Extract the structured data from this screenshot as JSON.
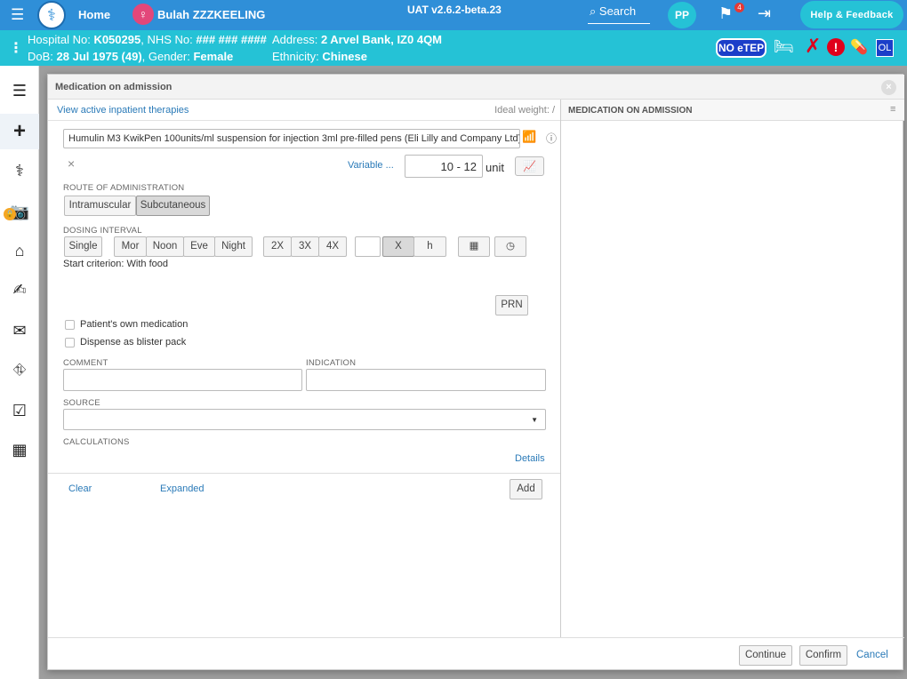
{
  "topbar": {
    "home_label": "Home",
    "patient_name": "Bulah ZZZKEELING",
    "version": "UAT v2.6.2-beta.23",
    "search_label": "Search",
    "user_initials": "PP",
    "flag_count": "4",
    "help_label": "Help & Feedback"
  },
  "patient": {
    "hospital_no_label": "Hospital No:",
    "hospital_no": "K050295",
    "nhs_no_label": ", NHS No:",
    "nhs_no": "### ### ####",
    "dob_label": "DoB:",
    "dob": "28 Jul 1975 (49)",
    "gender_label": ", Gender:",
    "gender": "Female",
    "address_label": "Address:",
    "address": "2 Arvel Bank, IZ0 4QM",
    "ethnicity_label": "Ethnicity:",
    "ethnicity": "Chinese",
    "badge_noetep": "NO eTEP",
    "badge_ol": "OL"
  },
  "modal": {
    "title": "Medication on admission",
    "view_link": "View active inpatient therapies",
    "ideal_weight": "Ideal weight: /",
    "right_title": "MEDICATION ON ADMISSION",
    "drug": "Humulin M3 KwikPen 100units/ml suspension for injection 3ml pre-filled pens (Eli Lilly and Company Ltd)",
    "variable_link": "Variable ...",
    "dose_value": "10 - 12",
    "dose_unit": "unit",
    "route_label": "ROUTE OF ADMINISTRATION",
    "routes": [
      "Intramuscular",
      "Subcutaneous"
    ],
    "dosing_label": "DOSING INTERVAL",
    "dosing_single": "Single",
    "dosing_times": [
      "Mor",
      "Noon",
      "Eve",
      "Night"
    ],
    "dosing_freq": [
      "2X",
      "3X",
      "4X"
    ],
    "dosing_x": "X",
    "dosing_h": "h",
    "start_criterion": "Start criterion: With food",
    "prn_label": "PRN",
    "own_med_label": "Patient's own medication",
    "blister_label": "Dispense as blister pack",
    "comment_label": "COMMENT",
    "indication_label": "INDICATION",
    "source_label": "SOURCE",
    "calculations_label": "CALCULATIONS",
    "details_link": "Details",
    "clear_link": "Clear",
    "expanded_link": "Expanded",
    "add_label": "Add",
    "continue_label": "Continue",
    "confirm_label": "Confirm",
    "cancel_label": "Cancel"
  },
  "colors": {
    "topbar": "#2f8fd8",
    "banner": "#25c2d6",
    "link": "#2a7ab8",
    "alert_red": "#e0001b",
    "badge_blue": "#1a3ec9"
  },
  "icons": [
    "menu-icon",
    "logo-icon",
    "patient-icon",
    "search-icon",
    "flag-icon",
    "logout-icon",
    "bed-icon",
    "x-icon",
    "alert-icon",
    "pill-icon",
    "list-icon",
    "plus-icon",
    "stethoscope-icon",
    "camera-icon",
    "lock-icon",
    "house-icon",
    "signature-icon",
    "inbox-icon",
    "running-icon",
    "checklist-icon",
    "building-icon",
    "wifi-icon",
    "info-icon",
    "chart-icon",
    "calendar-icon",
    "clock-icon",
    "close-icon"
  ]
}
